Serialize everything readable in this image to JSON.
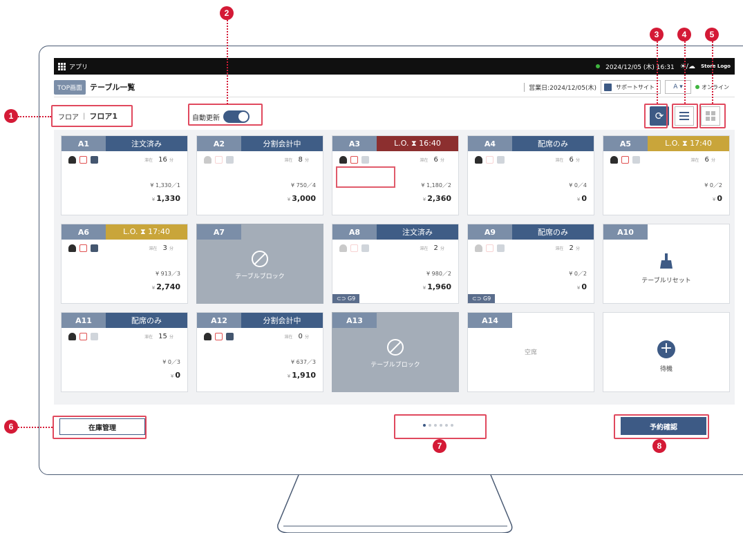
{
  "sysbar": {
    "apps_label": "アプリ",
    "datetime": "2024/12/05 (木) 16:31",
    "weather": "☀/☁",
    "logo": "Store Logo"
  },
  "header": {
    "top_button": "TOP画面",
    "title": "テーブル一覧",
    "business_date": "営業日:2024/12/05(木)",
    "support": "サポートサイト",
    "lang": "A ▾",
    "online": "オンライン"
  },
  "toolbar": {
    "floor_label": "フロア",
    "floor_value": "フロア1",
    "auto_refresh": "自動更新"
  },
  "tables": [
    {
      "no": "A1",
      "status": "注文済み",
      "time": "16",
      "guests": "¥ 1,330／1",
      "total": "1,330",
      "yen": "¥"
    },
    {
      "no": "A2",
      "status": "分割会計中",
      "time": "8",
      "guests": "¥ 750／4",
      "total": "3,000",
      "yen": "¥"
    },
    {
      "no": "A3",
      "status": "L.O. ⧗ 16:40",
      "time": "6",
      "guests": "¥ 1,180／2",
      "total": "2,360",
      "yen": "¥"
    },
    {
      "no": "A4",
      "status": "配席のみ",
      "time": "6",
      "guests": "¥ 0／4",
      "total": "0",
      "yen": "¥"
    },
    {
      "no": "A5",
      "status": "L.O. ⧗ 17:40",
      "time": "6",
      "guests": "¥ 0／2",
      "total": "0",
      "yen": "¥"
    },
    {
      "no": "A6",
      "status": "L.O. ⧗ 17:40",
      "time": "3",
      "guests": "¥ 913／3",
      "total": "2,740",
      "yen": "¥"
    },
    {
      "no": "A7",
      "block": "テーブルブロック"
    },
    {
      "no": "A8",
      "status": "注文済み",
      "time": "2",
      "guests": "¥ 980／2",
      "total": "1,960",
      "yen": "¥",
      "group": "⊂⊃ G9"
    },
    {
      "no": "A9",
      "status": "配席のみ",
      "time": "2",
      "guests": "¥ 0／2",
      "total": "0",
      "yen": "¥",
      "group": "⊂⊃ G9"
    },
    {
      "no": "A10",
      "reset": "テーブルリセット"
    },
    {
      "no": "A11",
      "status": "配席のみ",
      "time": "15",
      "guests": "¥ 0／3",
      "total": "0",
      "yen": "¥"
    },
    {
      "no": "A12",
      "status": "分割会計中",
      "time": "0",
      "guests": "¥ 637／3",
      "total": "1,910",
      "yen": "¥"
    },
    {
      "no": "A13",
      "block": "テーブルブロック"
    },
    {
      "no": "A14",
      "empty": "空席"
    },
    {
      "wait": "待機"
    }
  ],
  "time_unit": "分",
  "time_caption": "滞在",
  "bottom": {
    "stock": "在庫管理",
    "reserve": "予約確認"
  },
  "annotations": [
    "1",
    "2",
    "3",
    "4",
    "5",
    "6",
    "7",
    "8"
  ],
  "colors": {
    "navy": "#3f5d86",
    "red": "#8c2f2f",
    "gold": "#c9a53a",
    "highlight": "#e0485d"
  }
}
